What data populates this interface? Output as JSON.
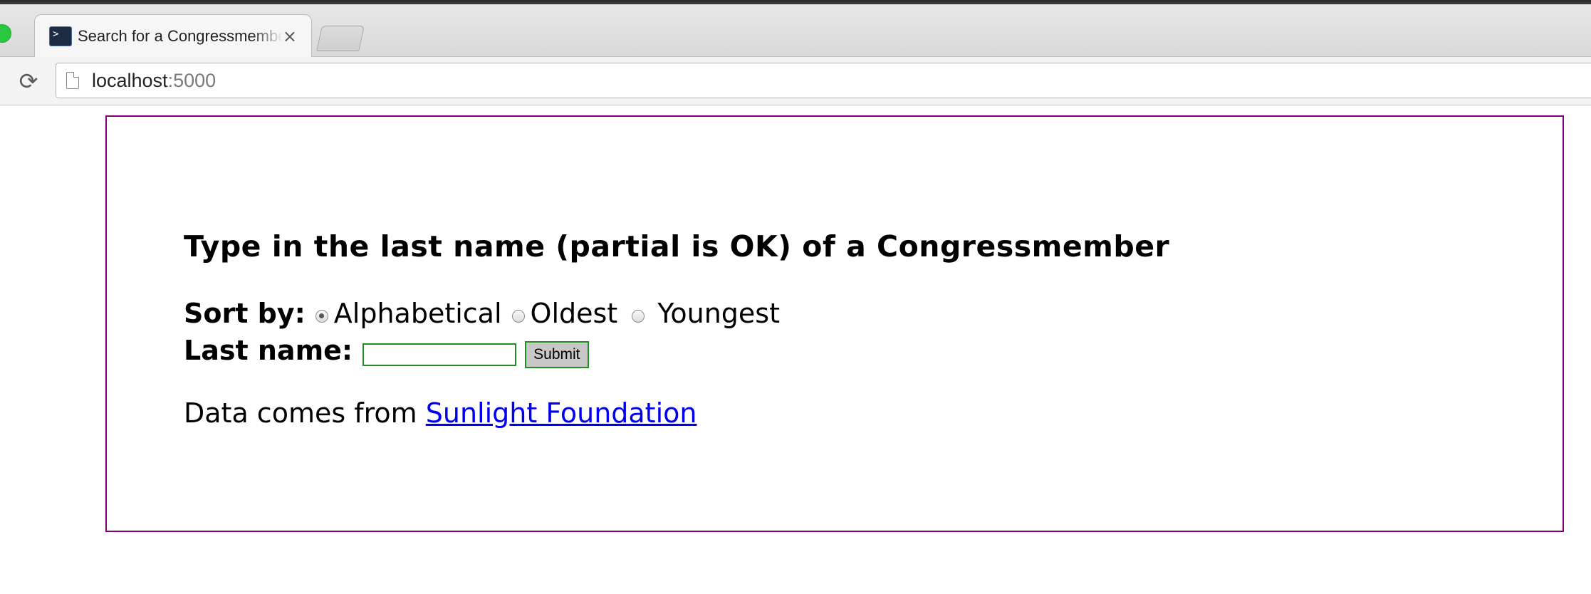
{
  "browser": {
    "tab_title": "Search for a Congressmember",
    "tab_close_icon": "×",
    "reload_icon": "⟳",
    "url_host": "localhost",
    "url_port": ":5000"
  },
  "page": {
    "heading": "Type in the last name (partial is OK) of a Congressmember",
    "sort_label": "Sort by:",
    "sort_options": [
      "Alphabetical",
      "Oldest",
      "Youngest"
    ],
    "sort_selected": "Alphabetical",
    "last_name_label": "Last name:",
    "last_name_value": "",
    "submit_label": "Submit",
    "source_prefix": "Data comes from",
    "source_link_text": "Sunlight Foundation"
  },
  "colors": {
    "frame_border": "#800080",
    "input_border": "#1f8f1f",
    "link": "#0000ee"
  }
}
